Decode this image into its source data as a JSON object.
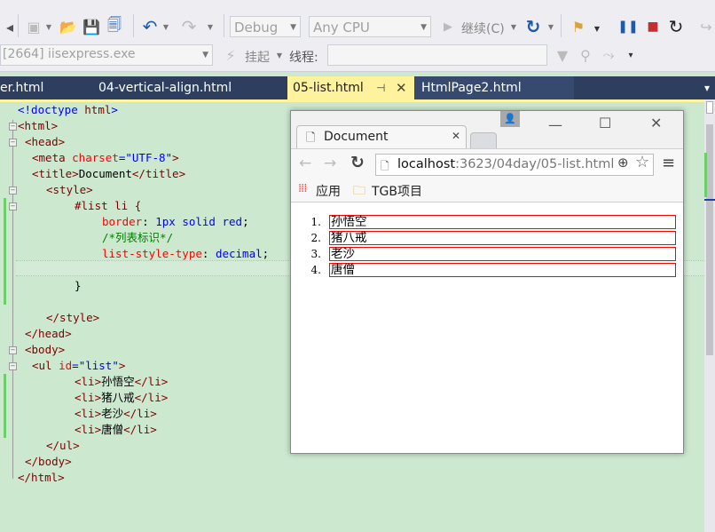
{
  "toolbar": {
    "config_dropdown": "Debug",
    "platform_dropdown": "Any CPU",
    "continue_label": "继续(C)",
    "process_value": "[2664] iisexpress.exe",
    "suspend_label": "挂起",
    "thread_label": "线程:"
  },
  "tabs": [
    {
      "label": "er.html"
    },
    {
      "label": "04-vertical-align.html"
    },
    {
      "label": "05-list.html",
      "active": true
    },
    {
      "label": "HtmlPage2.html"
    }
  ],
  "code": {
    "l1": {
      "a": "<!doctype ",
      "b": "html",
      "c": ">"
    },
    "l2": {
      "a": "<html>"
    },
    "l3": {
      "a": "<head>"
    },
    "l4": {
      "a": "<meta ",
      "b": "charset",
      "c": "=",
      "d": "\"UTF-8\"",
      "e": ">"
    },
    "l5": {
      "a": "<title>",
      "b": "Document",
      "c": "</title>"
    },
    "l6": {
      "a": "<style>"
    },
    "l7": {
      "a": "#list li {"
    },
    "l8": {
      "a": "border",
      "b": ": ",
      "c": "1px solid red",
      "d": ";"
    },
    "l9": {
      "a": "/*列表标识*/"
    },
    "l10": {
      "a": "list-style-type",
      "b": ": ",
      "c": "decimal",
      "d": ";"
    },
    "l12": {
      "a": "}"
    },
    "l14": {
      "a": "</style>"
    },
    "l15": {
      "a": "</head>"
    },
    "l16": {
      "a": "<body>"
    },
    "l17": {
      "a": "<ul ",
      "b": "id",
      "c": "=",
      "d": "\"list\"",
      "e": ">"
    },
    "l18": {
      "a": "<li>",
      "b": "孙悟空",
      "c": "</li>"
    },
    "l19": {
      "a": "<li>",
      "b": "猪八戒",
      "c": "</li>"
    },
    "l20": {
      "a": "<li>",
      "b": "老沙",
      "c": "</li>"
    },
    "l21": {
      "a": "<li>",
      "b": "唐僧",
      "c": "</li>"
    },
    "l22": {
      "a": "</ul>"
    },
    "l23": {
      "a": "</body>"
    },
    "l24": {
      "a": "</html>"
    }
  },
  "browser": {
    "tab_title": "Document",
    "url_host": "localhost",
    "url_rest": ":3623/04day/05-list.html",
    "bookmark_apps": "应用",
    "bookmark_folder": "TGB项目",
    "list": [
      {
        "num": "1.",
        "text": "孙悟空"
      },
      {
        "num": "2.",
        "text": "猪八戒"
      },
      {
        "num": "3.",
        "text": "老沙"
      },
      {
        "num": "4.",
        "text": "唐僧"
      }
    ]
  },
  "colors": {
    "editor_bg": "#cce8cf",
    "tab_bar": "#2d3e5f",
    "active_tab": "#fff29d",
    "list_border": "#ff0000"
  }
}
